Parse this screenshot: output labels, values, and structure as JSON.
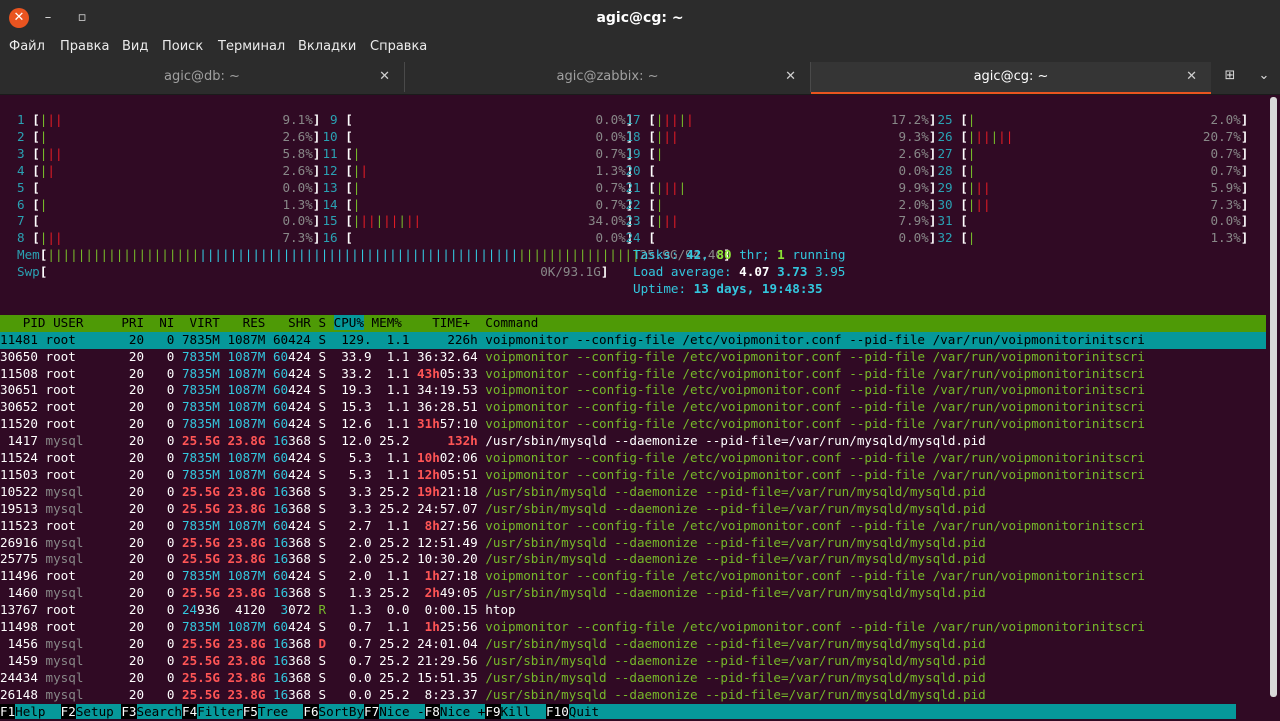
{
  "window": {
    "title": "agic@cg: ~"
  },
  "menu": [
    "Файл",
    "Правка",
    "Вид",
    "Поиск",
    "Терминал",
    "Вкладки",
    "Справка"
  ],
  "tabs": [
    {
      "label": "agic@db: ~",
      "active": false
    },
    {
      "label": "agic@zabbix: ~",
      "active": false
    },
    {
      "label": "agic@cg: ~",
      "active": true
    }
  ],
  "cpus": [
    {
      "n": "1",
      "bar": "|||",
      "pct": "9.1%"
    },
    {
      "n": "2",
      "bar": "|",
      "pct": "2.6%"
    },
    {
      "n": "3",
      "bar": "|||",
      "pct": "5.8%"
    },
    {
      "n": "4",
      "bar": "||",
      "pct": "2.6%"
    },
    {
      "n": "5",
      "bar": "",
      "pct": "0.0%"
    },
    {
      "n": "6",
      "bar": "|",
      "pct": "1.3%"
    },
    {
      "n": "7",
      "bar": "",
      "pct": "0.0%"
    },
    {
      "n": "8",
      "bar": "|||",
      "pct": "7.3%"
    },
    {
      "n": "9",
      "bar": "",
      "pct": "0.0%"
    },
    {
      "n": "10",
      "bar": "",
      "pct": "0.0%"
    },
    {
      "n": "11",
      "bar": "|",
      "pct": "0.7%"
    },
    {
      "n": "12",
      "bar": "||",
      "pct": "1.3%"
    },
    {
      "n": "13",
      "bar": "|",
      "pct": "0.7%"
    },
    {
      "n": "14",
      "bar": "|",
      "pct": "0.7%"
    },
    {
      "n": "15",
      "bar": "|||||||||",
      "pct": "34.0%"
    },
    {
      "n": "16",
      "bar": "",
      "pct": "0.0%"
    },
    {
      "n": "17",
      "bar": "|||||",
      "pct": "17.2%"
    },
    {
      "n": "18",
      "bar": "|||",
      "pct": "9.3%"
    },
    {
      "n": "19",
      "bar": "|",
      "pct": "2.6%"
    },
    {
      "n": "20",
      "bar": "",
      "pct": "0.0%"
    },
    {
      "n": "21",
      "bar": "||||",
      "pct": "9.9%"
    },
    {
      "n": "22",
      "bar": "|",
      "pct": "2.0%"
    },
    {
      "n": "23",
      "bar": "|||",
      "pct": "7.9%"
    },
    {
      "n": "24",
      "bar": "",
      "pct": "0.0%"
    },
    {
      "n": "25",
      "bar": "|",
      "pct": "2.0%"
    },
    {
      "n": "26",
      "bar": "||||||",
      "pct": "20.7%"
    },
    {
      "n": "27",
      "bar": "|",
      "pct": "0.7%"
    },
    {
      "n": "28",
      "bar": "|",
      "pct": "0.7%"
    },
    {
      "n": "29",
      "bar": "|||",
      "pct": "5.9%"
    },
    {
      "n": "30",
      "bar": "|||",
      "pct": "7.3%"
    },
    {
      "n": "31",
      "bar": "",
      "pct": "0.0%"
    },
    {
      "n": "32",
      "bar": "|",
      "pct": "1.3%"
    }
  ],
  "mem": {
    "label": "Mem",
    "bar": "||||||||||||||||||||||||||||||||||||||||||||||||||||||||||||||||||||||||||||||",
    "value": "25.9G/94.4G"
  },
  "swp": {
    "label": "Swp",
    "bar": "",
    "value": "0K/93.1G"
  },
  "tasks": {
    "label": "Tasks:",
    "tasks": "42",
    "thr": "80",
    "thr_label": "thr;",
    "running": "1",
    "running_label": "running"
  },
  "load": {
    "label": "Load average:",
    "l1": "4.07",
    "l5": "3.73",
    "l15": "3.95"
  },
  "uptime": {
    "label": "Uptime:",
    "value": "13 days, 19:48:35"
  },
  "header": [
    "PID",
    "USER",
    "PRI",
    "NI",
    "VIRT",
    "RES",
    "SHR",
    "S",
    "CPU%",
    "MEM%",
    "TIME+",
    "Command"
  ],
  "processes": [
    {
      "pid": "11481",
      "user": "root",
      "pri": "20",
      "ni": "0",
      "virt": "7835M",
      "res": "1087M",
      "shr": "60424",
      "s": "S",
      "cpu": "129.",
      "mem": "1.1",
      "time": "226h",
      "cmd": "voipmonitor --config-file /etc/voipmonitor.conf --pid-file /var/run/voipmonitorinitscri",
      "selected": true
    },
    {
      "pid": "30650",
      "user": "root",
      "pri": "20",
      "ni": "0",
      "virt": "7835M",
      "res": "1087M",
      "shr": "60424",
      "s": "S",
      "cpu": "33.9",
      "mem": "1.1",
      "time": "36:32.64",
      "cmd": "voipmonitor --config-file /etc/voipmonitor.conf --pid-file /var/run/voipmonitorinitscri"
    },
    {
      "pid": "11508",
      "user": "root",
      "pri": "20",
      "ni": "0",
      "virt": "7835M",
      "res": "1087M",
      "shr": "60424",
      "s": "S",
      "cpu": "33.2",
      "mem": "1.1",
      "time": "43h05:33",
      "cmd": "voipmonitor --config-file /etc/voipmonitor.conf --pid-file /var/run/voipmonitorinitscri"
    },
    {
      "pid": "30651",
      "user": "root",
      "pri": "20",
      "ni": "0",
      "virt": "7835M",
      "res": "1087M",
      "shr": "60424",
      "s": "S",
      "cpu": "19.3",
      "mem": "1.1",
      "time": "34:19.53",
      "cmd": "voipmonitor --config-file /etc/voipmonitor.conf --pid-file /var/run/voipmonitorinitscri"
    },
    {
      "pid": "30652",
      "user": "root",
      "pri": "20",
      "ni": "0",
      "virt": "7835M",
      "res": "1087M",
      "shr": "60424",
      "s": "S",
      "cpu": "15.3",
      "mem": "1.1",
      "time": "36:28.51",
      "cmd": "voipmonitor --config-file /etc/voipmonitor.conf --pid-file /var/run/voipmonitorinitscri"
    },
    {
      "pid": "11520",
      "user": "root",
      "pri": "20",
      "ni": "0",
      "virt": "7835M",
      "res": "1087M",
      "shr": "60424",
      "s": "S",
      "cpu": "12.6",
      "mem": "1.1",
      "time": "31h57:10",
      "cmd": "voipmonitor --config-file /etc/voipmonitor.conf --pid-file /var/run/voipmonitorinitscri"
    },
    {
      "pid": "1417",
      "user": "mysql",
      "pri": "20",
      "ni": "0",
      "virt": "25.5G",
      "res": "23.8G",
      "shr": "16368",
      "s": "S",
      "cpu": "12.0",
      "mem": "25.2",
      "time": "132h",
      "cmd": "/usr/sbin/mysqld --daemonize --pid-file=/var/run/mysqld/mysqld.pid"
    },
    {
      "pid": "11524",
      "user": "root",
      "pri": "20",
      "ni": "0",
      "virt": "7835M",
      "res": "1087M",
      "shr": "60424",
      "s": "S",
      "cpu": "5.3",
      "mem": "1.1",
      "time": "10h02:06",
      "cmd": "voipmonitor --config-file /etc/voipmonitor.conf --pid-file /var/run/voipmonitorinitscri"
    },
    {
      "pid": "11503",
      "user": "root",
      "pri": "20",
      "ni": "0",
      "virt": "7835M",
      "res": "1087M",
      "shr": "60424",
      "s": "S",
      "cpu": "5.3",
      "mem": "1.1",
      "time": "12h05:51",
      "cmd": "voipmonitor --config-file /etc/voipmonitor.conf --pid-file /var/run/voipmonitorinitscri"
    },
    {
      "pid": "10522",
      "user": "mysql",
      "pri": "20",
      "ni": "0",
      "virt": "25.5G",
      "res": "23.8G",
      "shr": "16368",
      "s": "S",
      "cpu": "3.3",
      "mem": "25.2",
      "time": "19h21:18",
      "cmd": "/usr/sbin/mysqld --daemonize --pid-file=/var/run/mysqld/mysqld.pid"
    },
    {
      "pid": "19513",
      "user": "mysql",
      "pri": "20",
      "ni": "0",
      "virt": "25.5G",
      "res": "23.8G",
      "shr": "16368",
      "s": "S",
      "cpu": "3.3",
      "mem": "25.2",
      "time": "24:57.07",
      "cmd": "/usr/sbin/mysqld --daemonize --pid-file=/var/run/mysqld/mysqld.pid"
    },
    {
      "pid": "11523",
      "user": "root",
      "pri": "20",
      "ni": "0",
      "virt": "7835M",
      "res": "1087M",
      "shr": "60424",
      "s": "S",
      "cpu": "2.7",
      "mem": "1.1",
      "time": "8h27:56",
      "cmd": "voipmonitor --config-file /etc/voipmonitor.conf --pid-file /var/run/voipmonitorinitscri"
    },
    {
      "pid": "26916",
      "user": "mysql",
      "pri": "20",
      "ni": "0",
      "virt": "25.5G",
      "res": "23.8G",
      "shr": "16368",
      "s": "S",
      "cpu": "2.0",
      "mem": "25.2",
      "time": "12:51.49",
      "cmd": "/usr/sbin/mysqld --daemonize --pid-file=/var/run/mysqld/mysqld.pid"
    },
    {
      "pid": "25775",
      "user": "mysql",
      "pri": "20",
      "ni": "0",
      "virt": "25.5G",
      "res": "23.8G",
      "shr": "16368",
      "s": "S",
      "cpu": "2.0",
      "mem": "25.2",
      "time": "10:30.20",
      "cmd": "/usr/sbin/mysqld --daemonize --pid-file=/var/run/mysqld/mysqld.pid"
    },
    {
      "pid": "11496",
      "user": "root",
      "pri": "20",
      "ni": "0",
      "virt": "7835M",
      "res": "1087M",
      "shr": "60424",
      "s": "S",
      "cpu": "2.0",
      "mem": "1.1",
      "time": "1h27:18",
      "cmd": "voipmonitor --config-file /etc/voipmonitor.conf --pid-file /var/run/voipmonitorinitscri"
    },
    {
      "pid": "1460",
      "user": "mysql",
      "pri": "20",
      "ni": "0",
      "virt": "25.5G",
      "res": "23.8G",
      "shr": "16368",
      "s": "S",
      "cpu": "1.3",
      "mem": "25.2",
      "time": "2h49:05",
      "cmd": "/usr/sbin/mysqld --daemonize --pid-file=/var/run/mysqld/mysqld.pid"
    },
    {
      "pid": "13767",
      "user": "root",
      "pri": "20",
      "ni": "0",
      "virt": "24936",
      "res": "4120",
      "shr": "3072",
      "s": "R",
      "cpu": "1.3",
      "mem": "0.0",
      "time": "0:00.15",
      "cmd": "htop"
    },
    {
      "pid": "11498",
      "user": "root",
      "pri": "20",
      "ni": "0",
      "virt": "7835M",
      "res": "1087M",
      "shr": "60424",
      "s": "S",
      "cpu": "0.7",
      "mem": "1.1",
      "time": "1h25:56",
      "cmd": "voipmonitor --config-file /etc/voipmonitor.conf --pid-file /var/run/voipmonitorinitscri"
    },
    {
      "pid": "1456",
      "user": "mysql",
      "pri": "20",
      "ni": "0",
      "virt": "25.5G",
      "res": "23.8G",
      "shr": "16368",
      "s": "D",
      "cpu": "0.7",
      "mem": "25.2",
      "time": "24:01.04",
      "cmd": "/usr/sbin/mysqld --daemonize --pid-file=/var/run/mysqld/mysqld.pid"
    },
    {
      "pid": "1459",
      "user": "mysql",
      "pri": "20",
      "ni": "0",
      "virt": "25.5G",
      "res": "23.8G",
      "shr": "16368",
      "s": "S",
      "cpu": "0.7",
      "mem": "25.2",
      "time": "21:29.56",
      "cmd": "/usr/sbin/mysqld --daemonize --pid-file=/var/run/mysqld/mysqld.pid"
    },
    {
      "pid": "24434",
      "user": "mysql",
      "pri": "20",
      "ni": "0",
      "virt": "25.5G",
      "res": "23.8G",
      "shr": "16368",
      "s": "S",
      "cpu": "0.0",
      "mem": "25.2",
      "time": "15:51.35",
      "cmd": "/usr/sbin/mysqld --daemonize --pid-file=/var/run/mysqld/mysqld.pid"
    },
    {
      "pid": "26148",
      "user": "mysql",
      "pri": "20",
      "ni": "0",
      "virt": "25.5G",
      "res": "23.8G",
      "shr": "16368",
      "s": "S",
      "cpu": "0.0",
      "mem": "25.2",
      "time": "8:23.37",
      "cmd": "/usr/sbin/mysqld --daemonize --pid-file=/var/run/mysqld/mysqld.pid"
    }
  ],
  "fkeys": [
    {
      "key": "F1",
      "label": "Help  "
    },
    {
      "key": "F2",
      "label": "Setup "
    },
    {
      "key": "F3",
      "label": "Search"
    },
    {
      "key": "F4",
      "label": "Filter"
    },
    {
      "key": "F5",
      "label": "Tree  "
    },
    {
      "key": "F6",
      "label": "SortBy"
    },
    {
      "key": "F7",
      "label": "Nice -"
    },
    {
      "key": "F8",
      "label": "Nice +"
    },
    {
      "key": "F9",
      "label": "Kill  "
    },
    {
      "key": "F10",
      "label": "Quit"
    }
  ]
}
